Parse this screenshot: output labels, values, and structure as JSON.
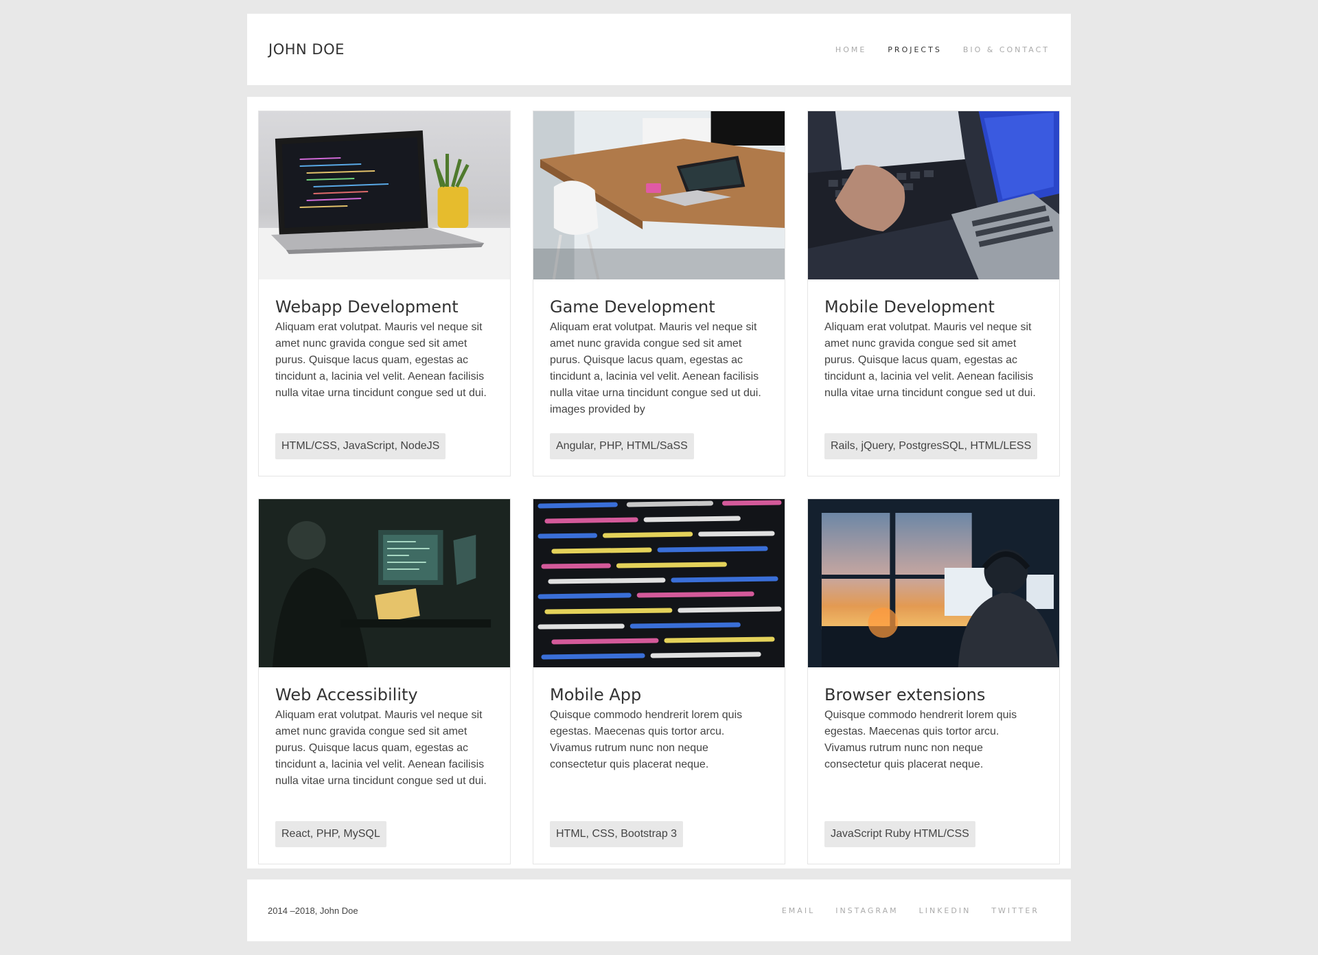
{
  "header": {
    "brand": "JOHN DOE",
    "nav": [
      {
        "label": "HOME"
      },
      {
        "label": "PROJECTS"
      },
      {
        "label": "BIO & CONTACT"
      }
    ]
  },
  "projects": [
    {
      "title": "Webapp Development",
      "description": "Aliquam erat volutpat. Mauris vel neque sit amet nunc gravida congue sed sit amet purus. Quisque lacus quam, egestas ac tincidunt a, lacinia vel velit. Aenean facilisis nulla vitae urna tincidunt congue sed ut dui.",
      "tags": "HTML/CSS, JavaScript, NodeJS",
      "image": "laptop-on-desk-photo"
    },
    {
      "title": "Game Development",
      "description": "Aliquam erat volutpat. Mauris vel neque sit amet nunc gravida congue sed sit amet purus. Quisque lacus quam, egestas ac tincidunt a, lacinia vel velit. Aenean facilisis nulla vitae urna tincidunt congue sed ut dui. images provided by",
      "tags": "Angular, PHP, HTML/SaSS",
      "image": "desk-workspace-photo"
    },
    {
      "title": "Mobile Development",
      "description": "Aliquam erat volutpat. Mauris vel neque sit amet nunc gravida congue sed sit amet purus. Quisque lacus quam, egestas ac tincidunt a, lacinia vel velit. Aenean facilisis nulla vitae urna tincidunt congue sed ut dui.",
      "tags": "Rails, jQuery, PostgresSQL, HTML/LESS",
      "image": "hands-typing-laptops-photo"
    },
    {
      "title": "Web Accessibility",
      "description": "Aliquam erat volutpat. Mauris vel neque sit amet nunc gravida congue sed sit amet purus. Quisque lacus quam, egestas ac tincidunt a, lacinia vel velit. Aenean facilisis nulla vitae urna tincidunt congue sed ut dui.",
      "tags": "React, PHP, MySQL",
      "image": "developer-dark-room-photo"
    },
    {
      "title": "Mobile App",
      "description": "Quisque commodo hendrerit lorem quis egestas. Maecenas quis tortor arcu. Vivamus rutrum nunc non neque consectetur quis placerat neque.",
      "tags": "HTML, CSS, Bootstrap 3",
      "image": "code-closeup-photo"
    },
    {
      "title": "Browser extensions",
      "description": "Quisque commodo hendrerit lorem quis egestas. Maecenas quis tortor arcu. Vivamus rutrum nunc non neque consectetur quis placerat neque.",
      "tags": "JavaScript Ruby HTML/CSS",
      "image": "developer-sunset-window-photo"
    }
  ],
  "footer": {
    "copyright": "2014 –2018, John Doe",
    "links": [
      {
        "label": "EMAIL"
      },
      {
        "label": "INSTAGRAM"
      },
      {
        "label": "LINKEDIN"
      },
      {
        "label": "TWITTER"
      }
    ]
  },
  "colors": {
    "page_background": "#e8e8e8",
    "panel_background": "#ffffff",
    "tag_background": "#e8e8e8",
    "nav_inactive": "#aaaaaa",
    "nav_active": "#333333"
  }
}
